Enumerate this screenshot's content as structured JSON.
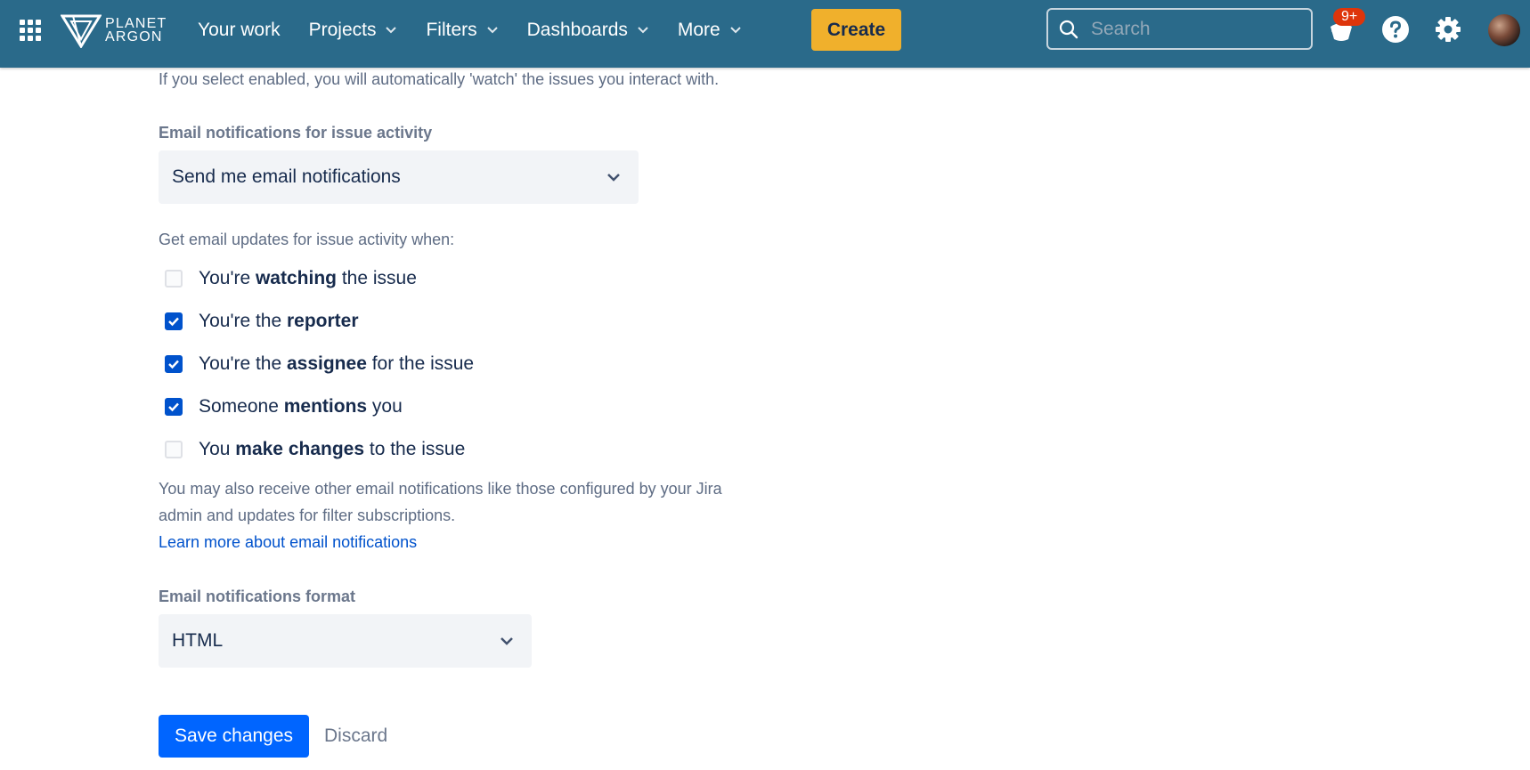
{
  "header": {
    "logo_text_line1": "PLANET",
    "logo_text_line2": "ARGON",
    "nav": [
      {
        "label": "Your work"
      },
      {
        "label": "Projects"
      },
      {
        "label": "Filters"
      },
      {
        "label": "Dashboards"
      },
      {
        "label": "More"
      }
    ],
    "create_label": "Create",
    "search_placeholder": "Search",
    "notification_count": "9+"
  },
  "settings": {
    "watch_intro": "If you select enabled, you will automatically 'watch' the issues you interact with.",
    "email_activity_label": "Email notifications for issue activity",
    "email_activity_value": "Send me email notifications",
    "updates_label": "Get email updates for issue activity when:",
    "checks": [
      {
        "pre": "You're ",
        "bold": "watching",
        "post": " the issue",
        "checked": false
      },
      {
        "pre": "You're the ",
        "bold": "reporter",
        "post": "",
        "checked": true
      },
      {
        "pre": "You're the ",
        "bold": "assignee",
        "post": " for the issue",
        "checked": true
      },
      {
        "pre": "Someone ",
        "bold": "mentions",
        "post": " you",
        "checked": true
      },
      {
        "pre": "You ",
        "bold": "make changes",
        "post": " to the issue",
        "checked": false
      }
    ],
    "other_note_line1": "You may also receive other email notifications like those configured by your Jira",
    "other_note_line2": "admin and updates for filter subscriptions.",
    "learn_more": "Learn more about email notifications",
    "format_label": "Email notifications format",
    "format_value": "HTML",
    "save_label": "Save changes",
    "discard_label": "Discard"
  },
  "colors": {
    "topbar": "#2a6a8a",
    "create": "#f0b02c",
    "primary": "#0065ff",
    "checkbox_checked": "#0052cc",
    "badge": "#de350b"
  },
  "icons": [
    "app-switcher-icon",
    "planet-argon-logo",
    "chevron-down-icon",
    "search-icon",
    "notification-icon",
    "help-icon",
    "gear-icon",
    "check-icon"
  ]
}
